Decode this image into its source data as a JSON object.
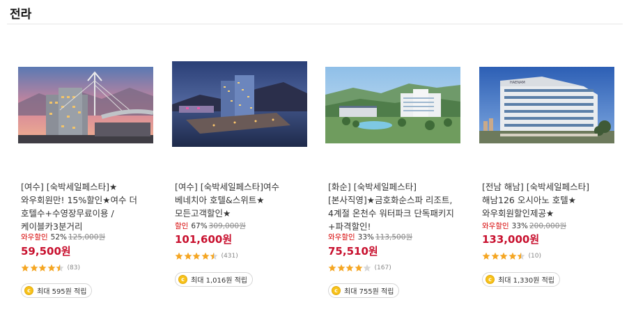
{
  "section": {
    "title": "전라"
  },
  "cards": [
    {
      "image_alt": "여수 더 호텔수 hotel exterior at sunset",
      "title": "[여수] [숙박세일페스타]★와우회원만! 15%할인★여수 더 호텔수+수영장무료이용 / 케이블카3분거리",
      "discount_label": "와우할인",
      "discount_percent": "52%",
      "original_price": "125,000원",
      "sale_price": "59,500원",
      "rating": 4.5,
      "review_count": "(83)",
      "points_text": "최대 595원 적립"
    },
    {
      "image_alt": "여수 베네치아 호텔 at night by the sea",
      "title": "[여수] [숙박세일페스타]여수 베네치아 호텔&스위트★모든고객할인★",
      "discount_label": "할인",
      "discount_percent": "67%",
      "original_price": "309,000원",
      "sale_price": "101,600원",
      "rating": 4.5,
      "review_count": "(431)",
      "points_text": "최대 1,016원 적립"
    },
    {
      "image_alt": "금호화순스파 리조트 with mountains and pool",
      "title": "[화순] [숙박세일페스타][본사직영]★금호화순스파 리조트, 4계절 온천수 워터파크 단독패키지+파격할인!",
      "discount_label": "와우할인",
      "discount_percent": "33%",
      "original_price": "113,500원",
      "sale_price": "75,510원",
      "rating": 4.0,
      "review_count": "(167)",
      "points_text": "최대 755원 적립"
    },
    {
      "image_alt": "해남126 오시아노 호텔 building",
      "title": "[전남 해남] [숙박세일페스타]해남126 오시아노 호텔★와우회원할인제공★",
      "discount_label": "와우할인",
      "discount_percent": "33%",
      "original_price": "200,000원",
      "sale_price": "133,000원",
      "rating": 4.5,
      "review_count": "(10)",
      "points_text": "최대 1,330원 적립"
    }
  ],
  "colors": {
    "discount_red": "#d60000",
    "price_red": "#c8102e",
    "star_orange": "#f5a623",
    "star_empty": "#d6d6d6",
    "coin_yellow": "#f7c21a"
  },
  "icons": {
    "star": "star-icon",
    "coin": "coin-icon"
  }
}
